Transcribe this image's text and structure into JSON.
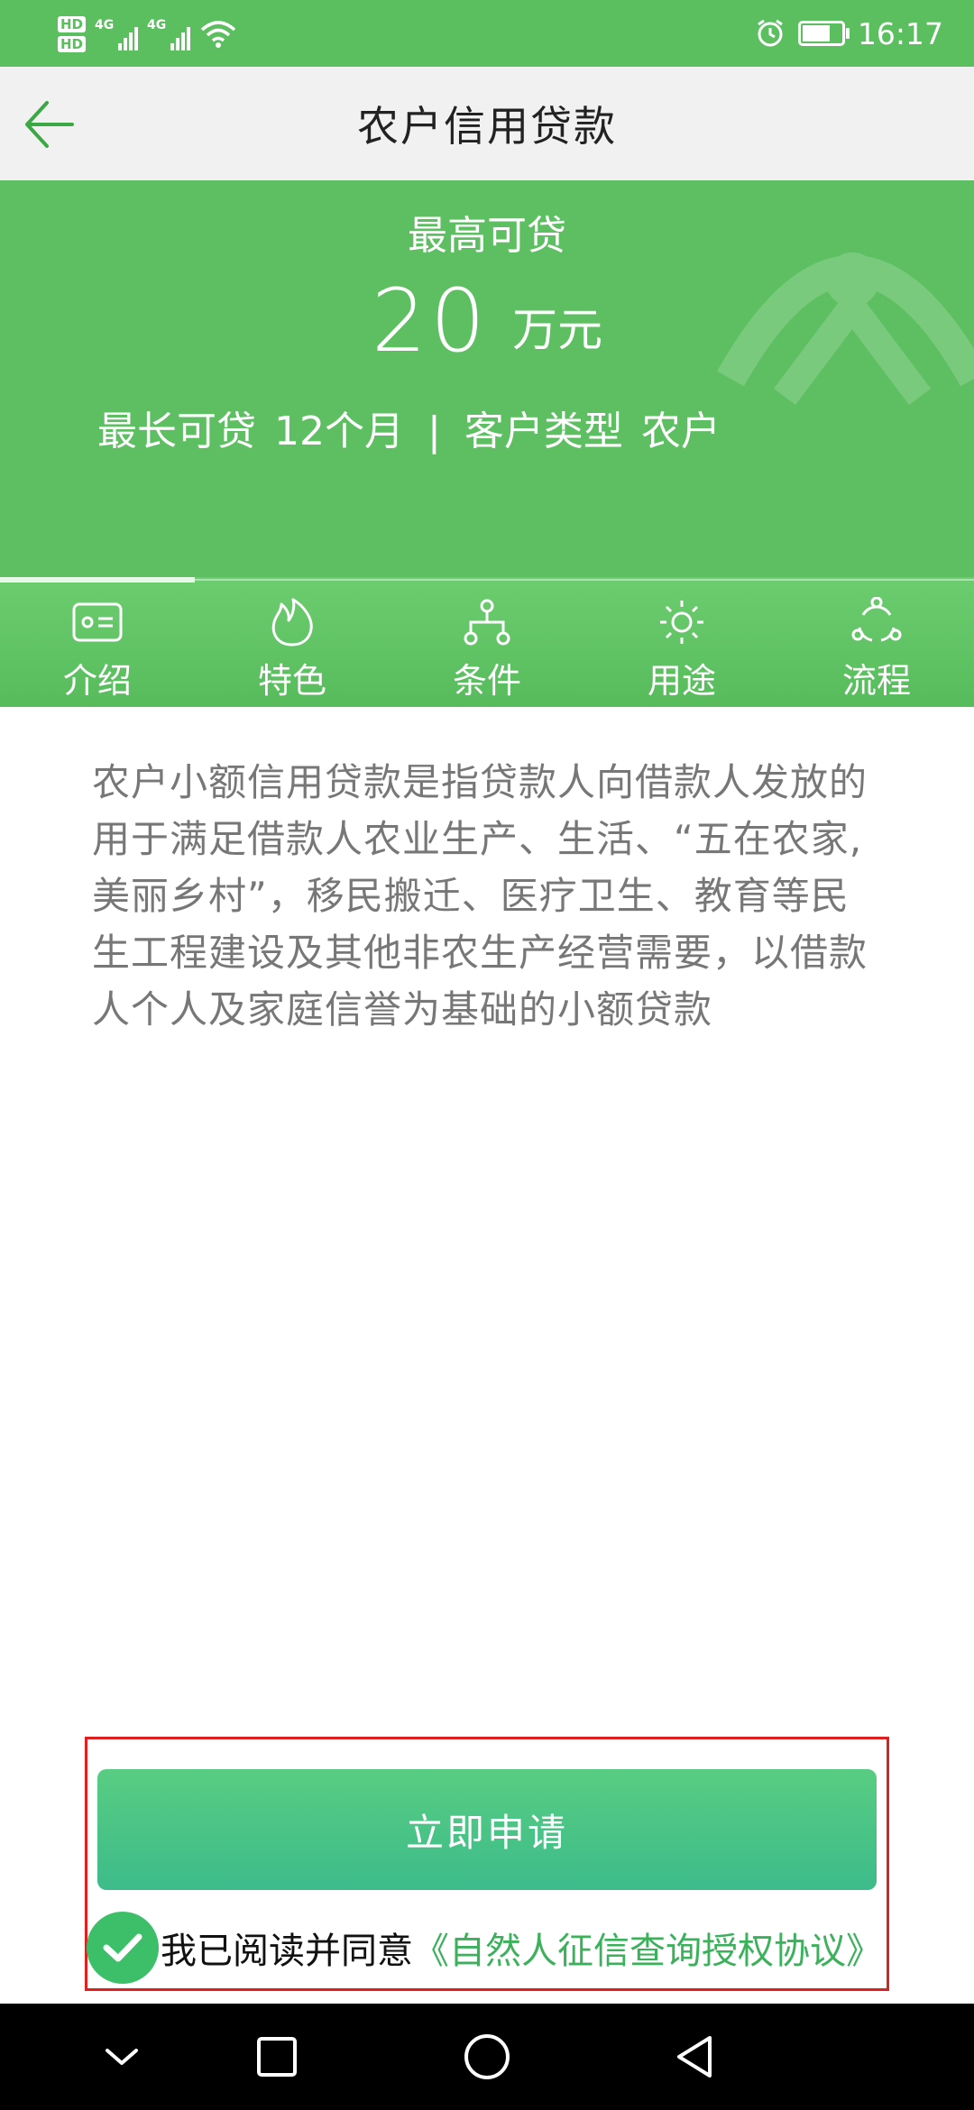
{
  "status_bar": {
    "sim1": "HD",
    "sim2": "HD",
    "network1": "4G",
    "network2": "4G",
    "time": "16:17",
    "battery_level": 0.8,
    "icons": [
      "hd-icon",
      "signal-icon",
      "wifi-icon",
      "alarm-icon",
      "battery-icon"
    ]
  },
  "header": {
    "title": "农户信用贷款",
    "back_icon": "arrow-left-icon"
  },
  "hero": {
    "label": "最高可贷",
    "amount": "20",
    "amount_unit": "万元",
    "term_label": "最长可贷",
    "term_value": "12个月",
    "separator": "|",
    "customer_type_label": "客户类型",
    "customer_type_value": "农户"
  },
  "tabs": [
    {
      "label": "介绍",
      "icon": "id-card-icon",
      "active": true
    },
    {
      "label": "特色",
      "icon": "flame-icon",
      "active": false
    },
    {
      "label": "条件",
      "icon": "hierarchy-icon",
      "active": false
    },
    {
      "label": "用途",
      "icon": "sun-icon",
      "active": false
    },
    {
      "label": "流程",
      "icon": "cycle-icon",
      "active": false
    }
  ],
  "description": "农户小额信用贷款是指贷款人向借款人发放的用于满足借款人农业生产、生活、“五在农家,美丽乡村”，移民搬迁、医疗卫生、教育等民生工程建设及其他非农生产经营需要，以借款人个人及家庭信誉为基础的小额贷款",
  "apply_button": "立即申请",
  "agreement": {
    "checked": true,
    "text": "我已阅读并同意",
    "link": "《自然人征信查询授权协议》"
  },
  "colors": {
    "primary_green": "#5dbf61",
    "button_green": "#3dbb8a",
    "link_green": "#3bb15b",
    "highlight_red": "#e02020"
  }
}
